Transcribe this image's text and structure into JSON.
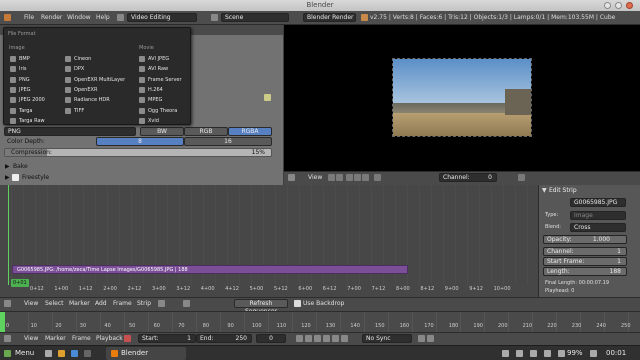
{
  "window": {
    "title": "Blender"
  },
  "infobar": {
    "menus": [
      "File",
      "Render",
      "Window",
      "Help"
    ],
    "screen_layout": "Video Editing",
    "scene": "Scene",
    "render_engine": "Blender Render",
    "stats": "v2.75 | Verts:8 | Faces:6 | Tris:12 | Objects:1/3 | Lamps:0/1 | Mem:103.55M | Cube"
  },
  "file_format_menu": {
    "title": "File Format",
    "image_header": "Image",
    "movie_header": "Movie",
    "col1": [
      "BMP",
      "Iris",
      "PNG",
      "JPEG",
      "JPEG 2000",
      "Targa",
      "Targa Raw"
    ],
    "col2": [
      "Cineon",
      "DPX",
      "OpenEXR MultiLayer",
      "OpenEXR",
      "Radiance HDR",
      "TIFF"
    ],
    "col3": [
      "AVI JPEG",
      "AVI Raw",
      "Frame Server",
      "H.264",
      "MPEG",
      "Ogg Theora",
      "Xvid"
    ]
  },
  "properties": {
    "format_value": "PNG",
    "color_modes": [
      "BW",
      "RGB",
      "RGBA"
    ],
    "color_depth_label": "Color Depth:",
    "color_depth_values": [
      "8",
      "16"
    ],
    "compression_label": "Compression:",
    "compression_value": "15%",
    "compression_fraction": 0.15,
    "bake_label": "Bake",
    "freestyle_label": "Freestyle"
  },
  "preview_header": {
    "view": "View",
    "channel_label": "Channel:",
    "channel_value": "0"
  },
  "sequencer": {
    "strip_label": "G0065985.JPG: /home/zeca/Time Lapse Images/G0065985.JPG | 188",
    "frame_badge": "0+01",
    "ticks": [
      "0+12",
      "1+00",
      "1+12",
      "2+00",
      "2+12",
      "3+00",
      "3+12",
      "4+00",
      "4+12",
      "5+00",
      "5+12",
      "6+00",
      "6+12",
      "7+00",
      "7+12",
      "8+00",
      "8+12",
      "9+00",
      "9+12",
      "10+00"
    ]
  },
  "edit_strip": {
    "title": "Edit Strip",
    "name_value": "G0065985.JPG",
    "type_label": "Type:",
    "type_value": "Image",
    "blend_label": "Blend:",
    "blend_value": "Cross",
    "opacity_label": "Opacity:",
    "opacity_value": "1.000",
    "channel_label": "Channel:",
    "channel_value": "1",
    "start_label": "Start Frame:",
    "start_value": "1",
    "length_label": "Length:",
    "length_value": "188",
    "final_length": "Final Length: 00:00:07.19",
    "playhead": "Playhead: 0"
  },
  "seq_header": {
    "items": [
      "View",
      "Select",
      "Marker",
      "Add",
      "Frame",
      "Strip"
    ],
    "refresh": "Refresh Sequencer",
    "backdrop": "Use Backdrop"
  },
  "timeline": {
    "ticks": [
      "0",
      "10",
      "20",
      "30",
      "40",
      "50",
      "60",
      "70",
      "80",
      "90",
      "100",
      "110",
      "120",
      "130",
      "140",
      "150",
      "160",
      "170",
      "180",
      "190",
      "200",
      "210",
      "220",
      "230",
      "240",
      "250"
    ]
  },
  "timeline_header": {
    "items": [
      "View",
      "Marker",
      "Frame",
      "Playback"
    ],
    "start_label": "Start:",
    "start_value": "1",
    "end_label": "End:",
    "end_value": "250",
    "current_frame": "0",
    "sync": "No Sync"
  },
  "taskbar": {
    "menu": "Menu",
    "app": "Blender",
    "battery": "99%",
    "clock": "00:01"
  }
}
